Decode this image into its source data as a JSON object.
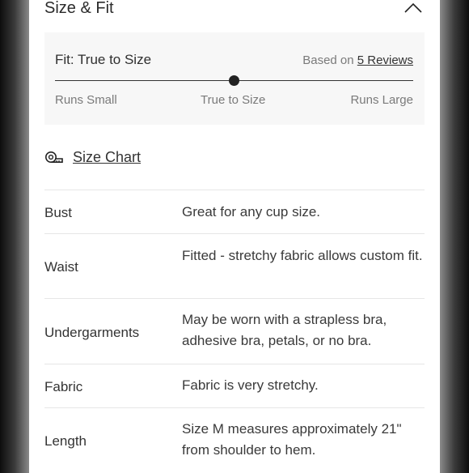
{
  "section": {
    "title": "Size & Fit",
    "collapse_icon": "chevron-up-icon"
  },
  "fit": {
    "label": "Fit: True to Size",
    "based_on_prefix": "Based on",
    "reviews_link": "5 Reviews",
    "slider_position": 0.5,
    "scale": {
      "left": "Runs Small",
      "middle": "True to Size",
      "right": "Runs Large"
    }
  },
  "size_chart": {
    "icon": "measuring-tape-icon",
    "label": "Size Chart"
  },
  "details": [
    {
      "label": "Bust",
      "value": "Great for any cup size."
    },
    {
      "label": "Waist",
      "value": "Fitted - stretchy fabric allows custom fit."
    },
    {
      "label": "Undergarments",
      "value": "May be worn with a strapless bra, adhesive bra, petals, or no bra."
    },
    {
      "label": "Fabric",
      "value": "Fabric is very stretchy."
    },
    {
      "label": "Length",
      "value": "Size M measures approximately 21\" from shoulder to hem."
    }
  ]
}
